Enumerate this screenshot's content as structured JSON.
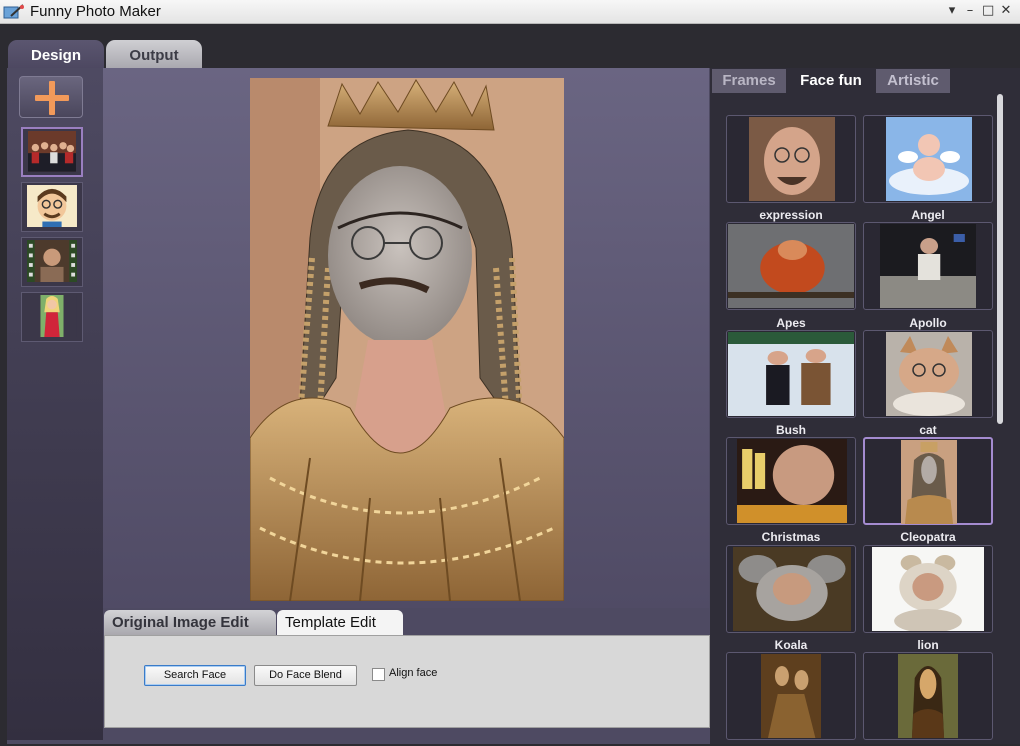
{
  "window": {
    "title": "Funny Photo Maker",
    "buttons": [
      "▾",
      "–",
      "□",
      "✕"
    ]
  },
  "main_tabs": [
    {
      "label": "Design",
      "active": true
    },
    {
      "label": "Output",
      "active": false
    }
  ],
  "left_strip": {
    "add_icon": "plus-icon",
    "thumbnails": [
      "group-photo",
      "cartoon-face",
      "film-portrait",
      "woman-red-dress"
    ],
    "selected_index": 0
  },
  "edit_tabs": [
    {
      "label": "Original Image Edit",
      "active": false
    },
    {
      "label": "Template Edit",
      "active": true
    }
  ],
  "edit_panel": {
    "search_face": "Search Face",
    "do_face_blend": "Do Face Blend",
    "align_face": "Align face",
    "align_face_checked": false
  },
  "right_tabs": [
    {
      "label": "Frames",
      "active": false
    },
    {
      "label": "Face fun",
      "active": true
    },
    {
      "label": "Artistic",
      "active": false
    }
  ],
  "templates": [
    {
      "label": "expression"
    },
    {
      "label": "Angel"
    },
    {
      "label": "Apes"
    },
    {
      "label": "Apollo"
    },
    {
      "label": "Bush"
    },
    {
      "label": "cat"
    },
    {
      "label": "Christmas"
    },
    {
      "label": "Cleopatra",
      "selected": true
    },
    {
      "label": "Koala"
    },
    {
      "label": "lion"
    },
    {
      "label": ""
    },
    {
      "label": ""
    }
  ],
  "colors": {
    "accent": "#f29a5a",
    "selected_border": "#a48bd0",
    "panel": "#4e4a62"
  }
}
